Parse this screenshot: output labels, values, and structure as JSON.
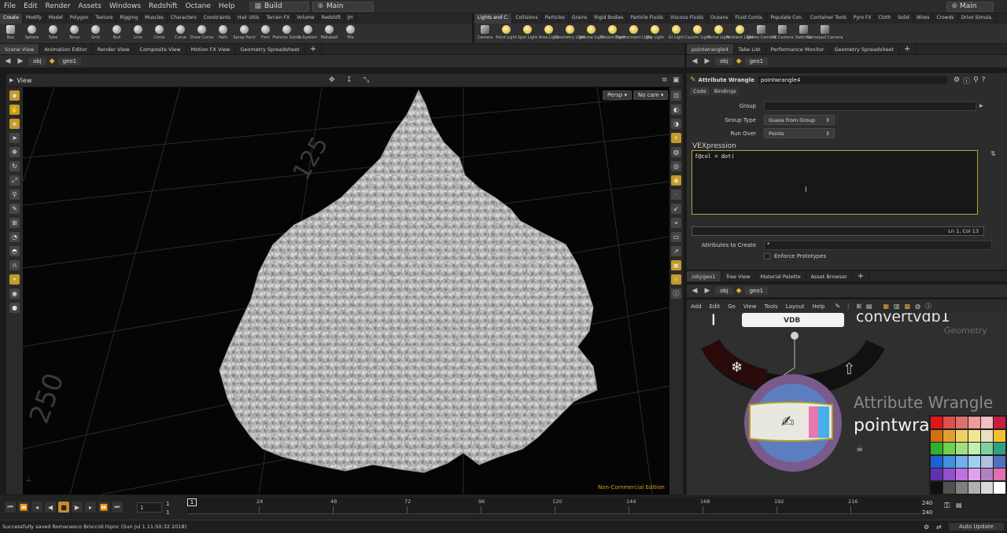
{
  "menubar": {
    "items": [
      "File",
      "Edit",
      "Render",
      "Assets",
      "Windows",
      "Redshift",
      "Octane",
      "Help"
    ],
    "desktop": "Build",
    "scene": "Main",
    "right_scene": "Main"
  },
  "shelf_left": {
    "tabs": [
      "Create",
      "Modify",
      "Model",
      "Polygon",
      "Texture",
      "Rigging",
      "Muscles",
      "Characters",
      "Constraints",
      "Hair Utils",
      "Terrain FX",
      "Volume",
      "Redshift",
      "JH"
    ],
    "tools": [
      "Box",
      "Sphere",
      "Tube",
      "Torus",
      "Grid",
      "Null",
      "Line",
      "Circle",
      "Curve",
      "Draw Curve",
      "Path",
      "Spray Paint",
      "Font",
      "Platonic Solids",
      "L-System",
      "Metaball",
      "File"
    ]
  },
  "shelf_right": {
    "tabs": [
      "Lights and C.",
      "Collisions",
      "Particles",
      "Grains",
      "Rigid Bodies",
      "Particle Fluids",
      "Viscous Fluids",
      "Oceans",
      "Fluid Conta.",
      "Populate Con.",
      "Container Tools",
      "Pyro FX",
      "Cloth",
      "Solid",
      "Wires",
      "Crowds",
      "Drive Simula."
    ],
    "tools": [
      "Camera",
      "Point Light",
      "Spot Light",
      "Area Light",
      "Geometry Light",
      "Volume Light",
      "Distant Light",
      "Environment Light",
      "Sky Light",
      "GI Light",
      "Caustic Light",
      "Portal Light",
      "Ambient Light",
      "Stereo Camera",
      "VR Camera",
      "Switcher",
      "Gamepad Camera"
    ]
  },
  "left_panetabs": [
    "Scene View",
    "Animation Editor",
    "Render View",
    "Composite View",
    "Motion FX View",
    "Geometry Spreadsheet"
  ],
  "left_path": {
    "obj": "obj",
    "geo": "geo1"
  },
  "viewport": {
    "title": "View",
    "persp": "Persp",
    "cam": "No cam",
    "grid_label_a": "125",
    "grid_label_b": "250",
    "watermark": "Non-Commercial Edition"
  },
  "param": {
    "panetabs": [
      "pointwrangle4",
      "Take List",
      "Performance Monitor",
      "Geometry Spreadsheet"
    ],
    "path": {
      "obj": "obj",
      "geo": "geo1"
    },
    "node_type": "Attribute Wrangle",
    "node_name": "pointwrangle4",
    "subtabs": [
      "Code",
      "Bindings"
    ],
    "group_label": "Group",
    "group_value": "",
    "group_type_label": "Group Type",
    "group_type_value": "Guess from Group",
    "run_over_label": "Run Over",
    "run_over_value": "Points",
    "vex_label": "VEXpression",
    "vex_code": "f@col = dot(",
    "cursor_pos": "Ln 1, Col 13",
    "attrs_label": "Attributes to Create",
    "attrs_value": "*",
    "enforce_label": "Enforce Prototypes"
  },
  "network": {
    "panetabs": [
      "/obj/geo1",
      "Tree View",
      "Material Palette",
      "Asset Browser"
    ],
    "path": {
      "obj": "obj",
      "geo": "geo1"
    },
    "menu": [
      "Add",
      "Edit",
      "Go",
      "View",
      "Tools",
      "Layout",
      "Help"
    ],
    "node1_name": "convertvdb1",
    "node1_context": "Geometry",
    "node1_badge": "VDB",
    "node2_type": "Attribute Wrangle",
    "node2_name": "pointwrangle4"
  },
  "timeline": {
    "current_frame": "1",
    "start": "1",
    "start2": "1",
    "ticks": [
      "24",
      "48",
      "72",
      "96",
      "120",
      "144",
      "168",
      "192",
      "216"
    ],
    "end": "240",
    "end2": "240",
    "playhead": "1"
  },
  "status": {
    "message": "Successfully saved Romanesco Broccoli.hipnc (Sun Jul 1 11:50:32 2018)",
    "update_mode": "Auto Update"
  },
  "palette_colors": [
    "#e01818",
    "#e05050",
    "#e07070",
    "#f09a9a",
    "#f0c0c0",
    "#c81c40",
    "#d07010",
    "#e0a030",
    "#f0d060",
    "#f0e890",
    "#e8e0c0",
    "#f0c030",
    "#30b030",
    "#70d050",
    "#a0e080",
    "#c0f0b0",
    "#80d0a0",
    "#30a080",
    "#2060d0",
    "#4090e0",
    "#70b0f0",
    "#a0d0f0",
    "#b0c0e0",
    "#5070c0",
    "#6030b0",
    "#9050d0",
    "#c070e0",
    "#e0a0f0",
    "#b080c0",
    "#e070b0",
    "#101010",
    "#505050",
    "#808080",
    "#b0b0b0",
    "#d8d8d8",
    "#ffffff"
  ]
}
